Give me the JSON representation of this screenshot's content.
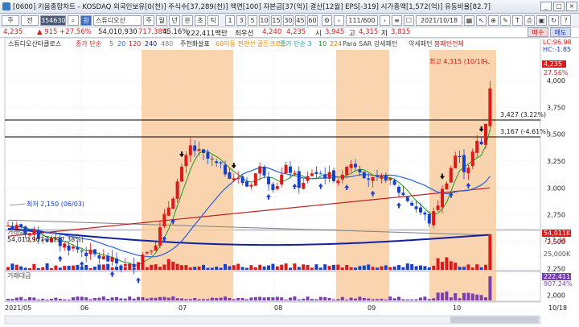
{
  "window": {
    "title": "[0600] 키움종합차트 - KOSDAQ 외국인보유[0(천)] 주식수[37,289(천)] 액면[100] 자본금[37(억)] 결산[12월] EPS[-319] 시가총액[1,572(억)] 유동비율[82.7]",
    "buttons": [
      "_",
      "□",
      "×"
    ]
  },
  "toolbar": {
    "type_label": "주",
    "period_label": "전",
    "code": "354630",
    "quote_label": "원",
    "name": "스튜디오산",
    "period_buttons": [
      "주",
      "월",
      "년",
      "분",
      "초",
      "틱"
    ],
    "intervals": [
      "1",
      "3",
      "5",
      "10",
      "15",
      "30",
      "45",
      "60"
    ],
    "count": "111/600",
    "date": "2021/10/18"
  },
  "infobar": {
    "price": "4,235",
    "change": "▲ 915 +27.56%",
    "volume": "54,010,930",
    "vol_ratio": "717.38%",
    "turnover": "45.16%",
    "amount": "222,411백만",
    "high_low_label": "최우선",
    "ask": "4,240",
    "bid": "4,235",
    "open_label": "시",
    "open": "3,945",
    "high_label": "고",
    "high": "4,315",
    "low_label": "저",
    "low": "3,815",
    "buy_button": "매수",
    "sell_button": "매도"
  },
  "legend": {
    "name": "스튜디오산타클로스",
    "ma_label": "종가 단순",
    "ma_periods": [
      "5",
      "20",
      "120",
      "240",
      "480"
    ],
    "signal1": "주천화살표",
    "signal2": "60이동 전관선 골든크로스",
    "ma2_label": "종가 단순 3",
    "ma2_periods": [
      "10",
      "224"
    ],
    "signal3": "Para SAR 강세패턴",
    "signal4": "약세패턴",
    "signal5": "봉패턴전체"
  },
  "price_axis": {
    "labels": [
      "4,000",
      "3,750",
      "3,500",
      "3,250",
      "3,000",
      "2,750",
      "2,500",
      "2,250",
      "2,000"
    ],
    "current": "4,235",
    "current_pct": "27.56%",
    "lc_label": "LC:96.98",
    "hc_label": "HC:-1.85"
  },
  "annotations": {
    "max": "최고 4,315 (10/18)",
    "min": "최저 2,150 (06/03)",
    "level1": "3,427 (3.22%)",
    "level2": "3,167 (-4.61%)"
  },
  "volume_panel": {
    "title": "거래량",
    "value": "54,010,907주(717.38%)",
    "axis_current": "54,011K",
    "axis_pct": "717.38",
    "axis_label": "25,000K"
  },
  "amount_panel": {
    "title": "거래대금",
    "axis_current": "222,411",
    "axis_pct": "907.24%"
  },
  "x_axis": {
    "labels": [
      "2021/05",
      "06",
      "07",
      "08",
      "09",
      "10"
    ],
    "right_label": "10/18"
  },
  "colors": {
    "up": "#e01818",
    "down": "#1840d0",
    "highlight": "#f8cda0",
    "ma5": "#1c9c1c",
    "ma20": "#2b5fd8",
    "ma120": "#c02020",
    "ma240": "#1020a0",
    "ma480": "#808080"
  }
}
